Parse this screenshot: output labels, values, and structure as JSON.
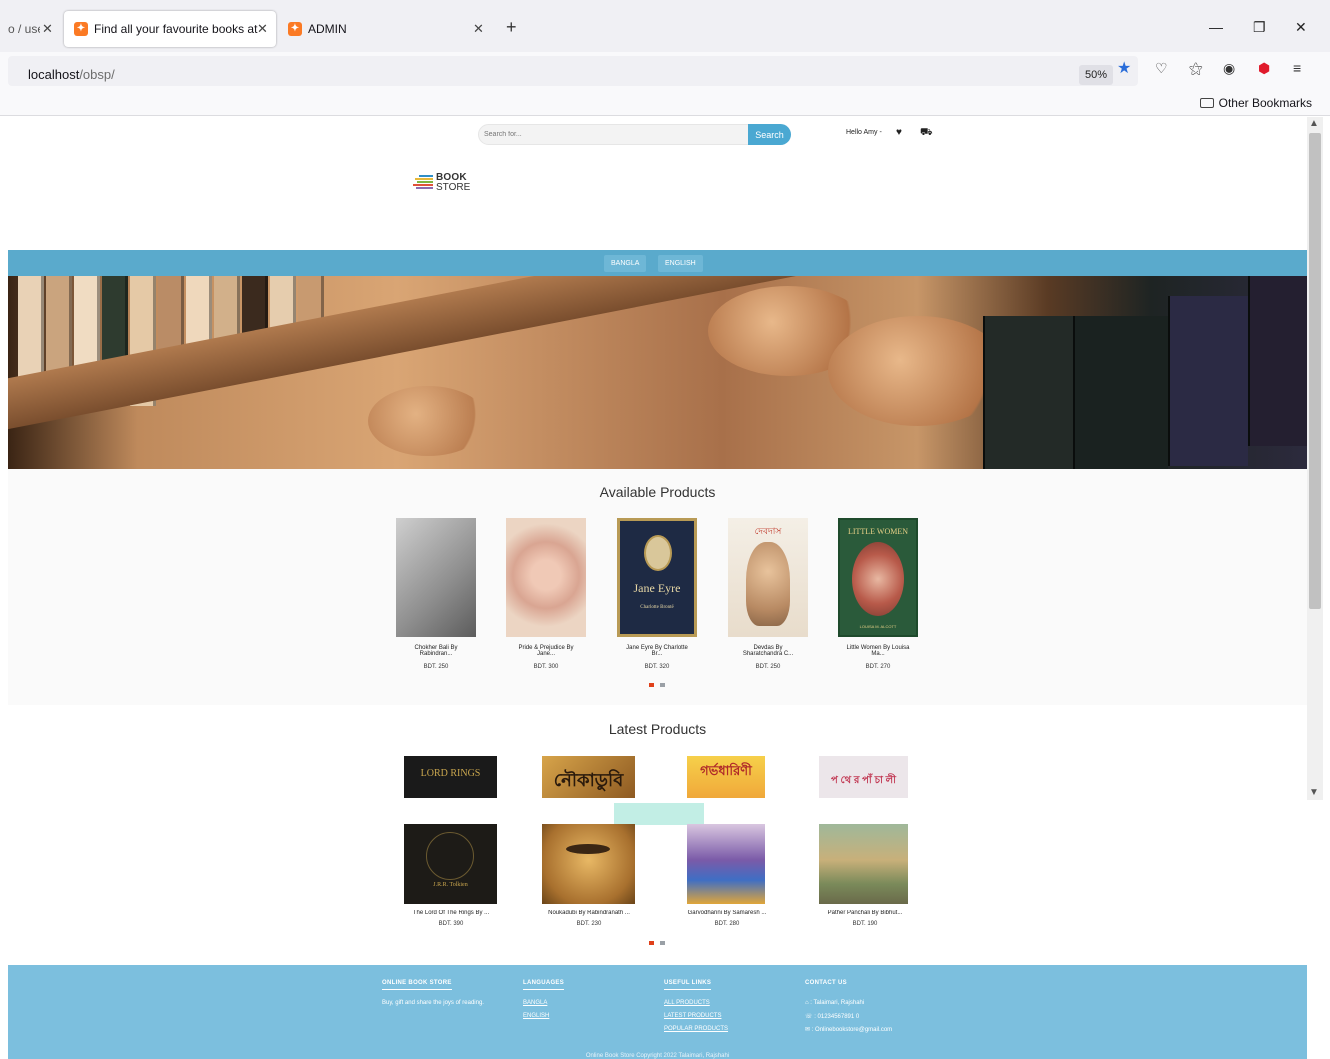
{
  "browser": {
    "tabs": [
      {
        "title": "o / use"
      },
      {
        "title": "Find all your favourite books at"
      },
      {
        "title": "ADMIN"
      }
    ],
    "new_tab_glyph": "+",
    "url_host": "localhost",
    "url_path": "/obsp/",
    "zoom": "50%",
    "other_bookmarks": "Other Bookmarks",
    "icons": [
      "star-icon",
      "pocket-icon",
      "extensions-icon",
      "account-icon",
      "shield-icon",
      "menu-icon"
    ]
  },
  "header": {
    "search_placeholder": "Search for...",
    "search_button": "Search",
    "greeting": "Hello Amy -",
    "logo_line1": "BOOK",
    "logo_line2": "STORE"
  },
  "nav": {
    "items": [
      "BANGLA",
      "ENGLISH"
    ]
  },
  "available": {
    "title": "Available Products",
    "products": [
      {
        "name_line1": "Chokher Bali By",
        "name_line2": "Rabindran...",
        "price": "BDT. 250"
      },
      {
        "name_line1": "Pride & Prejudice By",
        "name_line2": "Jane...",
        "price": "BDT. 300"
      },
      {
        "name_line1": "Jane Eyre By Charlotte",
        "name_line2": "Br...",
        "price": "BDT. 320"
      },
      {
        "name_line1": "Devdas By",
        "name_line2": "Sharatchandra C...",
        "price": "BDT. 250"
      },
      {
        "name_line1": "Little Women By Louisa",
        "name_line2": "Ma...",
        "price": "BDT. 270"
      }
    ],
    "cover_texts": {
      "jane_eyre_title": "Jane Eyre",
      "jane_eyre_author": "Charlotte Brontë",
      "little_women_title": "LITTLE WOMEN",
      "little_women_author": "LOUISA M. ALCOTT",
      "devdas_title": "দেবদাস"
    }
  },
  "latest": {
    "title": "Latest Products",
    "top_row": [
      {
        "cover_text": "LORD RINGS"
      },
      {
        "cover_text": "নৌকাডুবি"
      },
      {
        "cover_text": "গর্ভধারিণী"
      },
      {
        "cover_text": "প থে র পাঁ চা লী"
      }
    ],
    "products": [
      {
        "name": "The Lord Of The Rings By ...",
        "price": "BDT. 390"
      },
      {
        "name": "Noukadubi By Rabindranath ...",
        "price": "BDT. 230"
      },
      {
        "name": "Garvodharini By Samaresh ...",
        "price": "BDT. 280"
      },
      {
        "name": "Pather Panchali By Bibhut...",
        "price": "BDT. 190"
      }
    ],
    "bottom_cover_texts": {
      "lotr_author": "J.R.R. Tolkien"
    }
  },
  "footer": {
    "col1": {
      "heading": "ONLINE BOOK STORE",
      "text": "Buy, gift and share the joys of reading."
    },
    "col2": {
      "heading": "LANGUAGES",
      "links": [
        "BANGLA",
        "ENGLISH"
      ]
    },
    "col3": {
      "heading": "USEFUL LINKS",
      "links": [
        "ALL PRODUCTS",
        "LATEST PRODUCTS",
        "POPULAR PRODUCTS"
      ]
    },
    "col4": {
      "heading": "CONTACT US",
      "address": ": Talaimari, Rajshahi",
      "phone": ": 01234567891 0",
      "email": ": Onlinebookstore@gmail.com"
    },
    "copyright": "Online Book Store Copyright 2022 Talaimari, Rajshahi"
  },
  "colors": {
    "accent": "#4aa8d2",
    "nav": "#5aaacc",
    "footer": "#7cbfde",
    "active_dot": "#e0401a"
  }
}
